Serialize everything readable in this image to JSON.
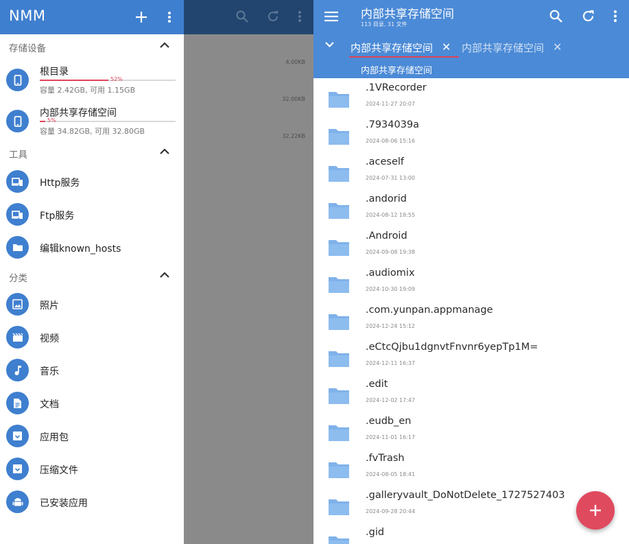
{
  "drawer": {
    "title": "NMM",
    "sections": {
      "storage": "存储设备",
      "tools": "工具",
      "category": "分类"
    },
    "devices": [
      {
        "label": "根目录",
        "percent_text": "52%",
        "percent": 52,
        "capacity": "容量 2.42GB, 可用 1.15GB"
      },
      {
        "label": "内部共享存储空间",
        "percent_text": "5%",
        "percent": 5,
        "capacity": "容量 34.82GB, 可用 32.80GB"
      }
    ],
    "tools": [
      "Http服务",
      "Ftp服务",
      "编辑known_hosts"
    ],
    "categories": [
      "照片",
      "视频",
      "音乐",
      "文档",
      "应用包",
      "压缩文件",
      "已安装应用"
    ]
  },
  "middle": {
    "sizes": [
      "4.00KB",
      "32.00KB",
      "32.22KB"
    ]
  },
  "main": {
    "title": "内部共享存储空间",
    "subtitle": "113 目录, 31 文件",
    "tabs": [
      "内部共享存储空间",
      "内部共享存储空间"
    ],
    "hint": "内部共享存储空间",
    "files": [
      {
        "name": ".1VRecorder",
        "date": "2024-11-27 20:07"
      },
      {
        "name": ".7934039a",
        "date": "2024-08-06 15:16"
      },
      {
        "name": ".aceself",
        "date": "2024-07-31 13:00"
      },
      {
        "name": ".andorid",
        "date": "2024-08-12 18:55"
      },
      {
        "name": ".Android",
        "date": "2024-09-08 19:38"
      },
      {
        "name": ".audiomix",
        "date": "2024-10-30 19:09"
      },
      {
        "name": ".com.yunpan.appmanage",
        "date": "2024-12-24 15:12"
      },
      {
        "name": ".eCtcQjbu1dgnvtFnvnr6yepTp1M=",
        "date": "2024-12-11 16:37"
      },
      {
        "name": ".edit",
        "date": "2024-12-02 17:47"
      },
      {
        "name": ".eudb_en",
        "date": "2024-11-01 16:17"
      },
      {
        "name": ".fvTrash",
        "date": "2024-08-05 18:41"
      },
      {
        "name": ".galleryvault_DoNotDelete_1727527403",
        "date": "2024-09-28 20:44"
      },
      {
        "name": ".gid",
        "date": ""
      }
    ]
  },
  "colors": {
    "primary": "#4b8ad6",
    "drawer_bar": "#3f7fcf",
    "accent": "#e0425a",
    "folder": "#7fb2ea"
  },
  "icons": {
    "toolbar": [
      "menu-icon",
      "search-icon",
      "refresh-icon",
      "more-vert-icon",
      "add-icon"
    ],
    "devices": [
      "phone-icon",
      "phone-icon"
    ],
    "tools": [
      "devices-icon",
      "devices-icon",
      "folder-icon"
    ],
    "categories": [
      "image-icon",
      "movie-icon",
      "music-note-icon",
      "document-icon",
      "archive-icon",
      "archive-icon",
      "android-icon"
    ]
  }
}
